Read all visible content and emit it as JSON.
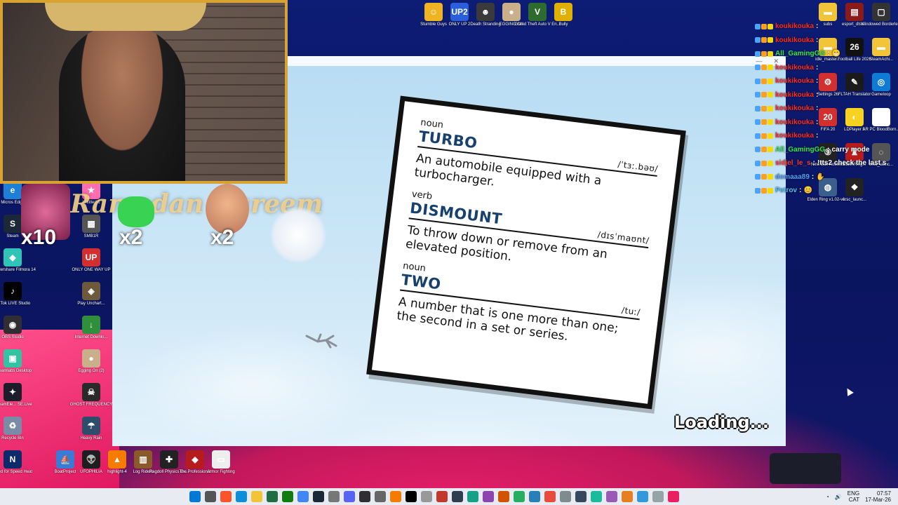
{
  "desktop": {
    "top_icons": [
      {
        "label": "Stumble Guys",
        "icon": "stumble-guys-icon",
        "color": "#f0b322",
        "glyph": "☺"
      },
      {
        "label": "ONLY UP 2",
        "icon": "only-up-icon",
        "color": "#2b5fd9",
        "glyph": "UP2"
      },
      {
        "label": "Death Stranding",
        "icon": "death-stranding-icon",
        "color": "#3a3a3a",
        "glyph": "☻"
      },
      {
        "label": "EGGING ON",
        "icon": "egg-icon",
        "color": "#c9b08a",
        "glyph": "●"
      },
      {
        "label": "Grand Theft Auto V En...",
        "icon": "gta-icon",
        "color": "#2e6b2e",
        "glyph": "V"
      },
      {
        "label": "Bully",
        "icon": "bully-icon",
        "color": "#e0b000",
        "glyph": "B"
      }
    ],
    "left_icons": [
      {
        "label": "Micros Edge",
        "icon": "edge-icon",
        "color": "#1e7fd6",
        "glyph": "e"
      },
      {
        "label": "Steam",
        "icon": "steam-icon",
        "color": "#1b2838",
        "glyph": "S"
      },
      {
        "label": "Wondershare Filmora 14",
        "icon": "filmora-icon",
        "color": "#2ec4b6",
        "glyph": "◆"
      },
      {
        "label": "TikTok LIVE Studio",
        "icon": "tiktok-icon",
        "color": "#000000",
        "glyph": "♪"
      },
      {
        "label": "OBS Studio",
        "icon": "obs-icon",
        "color": "#302e31",
        "glyph": "◉"
      },
      {
        "label": "Streamlabs Desktop",
        "icon": "streamlabs-icon",
        "color": "#31c3a2",
        "glyph": "▣"
      },
      {
        "label": "StreamEle... SE.Live",
        "icon": "streamelements-icon",
        "color": "#1c1c2a",
        "glyph": "✦"
      },
      {
        "label": "Recycle Bin",
        "icon": "recycle-bin-icon",
        "color": "#7a8ba6",
        "glyph": "♻"
      },
      {
        "label": "Need for Speed Heat",
        "icon": "nfs-icon",
        "color": "#0d2a6b",
        "glyph": "N"
      }
    ],
    "left_icons_col2": [
      {
        "label": "Untitled 1",
        "icon": "fall-guys-icon",
        "color": "#ff6fb0",
        "glyph": "★"
      },
      {
        "label": "SMB1R",
        "icon": "smb-icon",
        "color": "#555555",
        "glyph": "▦"
      },
      {
        "label": "ONLY ONE WAY UP",
        "icon": "only-one-way-up-icon",
        "color": "#d32f2f",
        "glyph": "UP"
      },
      {
        "label": "Play Unchart...",
        "icon": "uncharted-icon",
        "color": "#6d5a3c",
        "glyph": "◈"
      },
      {
        "label": "Internet Downlo...",
        "icon": "idm-icon",
        "color": "#2f8f3a",
        "glyph": "↓"
      },
      {
        "label": "Egging On (2)",
        "icon": "egg-icon-2",
        "color": "#c9b08a",
        "glyph": "●"
      },
      {
        "label": "GHOST FREQUENCY",
        "icon": "ghost-icon",
        "color": "#2a2a2a",
        "glyph": "☠"
      },
      {
        "label": "Heavy Rain",
        "icon": "heavy-rain-icon",
        "color": "#2e4d6b",
        "glyph": "☂"
      }
    ],
    "bottom_icons": [
      {
        "label": "BoatProject",
        "icon": "boat-icon",
        "color": "#3a7bd5",
        "glyph": "⛵"
      },
      {
        "label": "UFOPHILIA",
        "icon": "ufo-icon",
        "color": "#1e1e1e",
        "glyph": "👽"
      },
      {
        "label": "highlight-4",
        "icon": "vlc-icon",
        "color": "#f57c00",
        "glyph": "▲"
      },
      {
        "label": "Log Riders",
        "icon": "log-riders-icon",
        "color": "#8b5a2b",
        "glyph": "▥"
      },
      {
        "label": "Ragdoll Physics Ex...",
        "icon": "ragdoll-icon",
        "color": "#222222",
        "glyph": "✚"
      },
      {
        "label": "The Professional",
        "icon": "professional-icon",
        "color": "#b71c1c",
        "glyph": "◆"
      },
      {
        "label": "Armor Fighting",
        "icon": "armor-icon",
        "color": "#eeeeee",
        "glyph": "▭"
      }
    ],
    "right_icons": [
      {
        "label": "subs",
        "icon": "folder-icon",
        "color": "#f2c438",
        "glyph": "▬"
      },
      {
        "label": "esport_dtss...",
        "icon": "winrar-icon",
        "color": "#8b1a1a",
        "glyph": "▤"
      },
      {
        "label": "Windowed Borderle...",
        "icon": "windowed-icon",
        "color": "#333333",
        "glyph": "▢"
      },
      {
        "label": "idle_master...",
        "icon": "folder-icon-2",
        "color": "#f2c438",
        "glyph": "▬"
      },
      {
        "label": "Football Life 2026",
        "icon": "football-icon",
        "color": "#111111",
        "glyph": "26"
      },
      {
        "label": "SteamAchi...",
        "icon": "folder-icon-3",
        "color": "#f2c438",
        "glyph": "▬"
      },
      {
        "label": "Settings 26",
        "icon": "settings-icon",
        "color": "#d32f2f",
        "glyph": "⚙"
      },
      {
        "label": "FLTAH Translator",
        "icon": "translator-icon",
        "color": "#1a1a1a",
        "glyph": "✎"
      },
      {
        "label": "Gameloop",
        "icon": "gameloop-icon",
        "color": "#0e7cd6",
        "glyph": "◎"
      },
      {
        "label": "FIFA 20",
        "icon": "fifa-icon",
        "color": "#d32f2f",
        "glyph": "20"
      },
      {
        "label": "LDPlayer 9",
        "icon": "ldplayer-icon",
        "color": "#f7d21e",
        "glyph": "◐"
      },
      {
        "label": "AR PC BloodBorn...",
        "icon": "bloodborne-icon",
        "color": "#ffffff",
        "glyph": "▯"
      },
      {
        "label": "Nine Ball Roulette",
        "icon": "nine-ball-icon",
        "color": "#222222",
        "glyph": "⑨"
      },
      {
        "label": "EldenRing...",
        "icon": "elden-ring-icon",
        "color": "#b71c1c",
        "glyph": "♜"
      },
      {
        "label": "ersc_launc...",
        "icon": "ersc-icon",
        "color": "#555555",
        "glyph": "◌"
      },
      {
        "label": "Elden Ring v1.02-v1...",
        "icon": "elden-ring-icon-2",
        "color": "#3a5f8a",
        "glyph": "◍"
      },
      {
        "label": "ersc_launc...",
        "icon": "ersc-icon-2",
        "color": "#222222",
        "glyph": "❖"
      }
    ]
  },
  "overlay": {
    "banner": "Ramadan Kareem",
    "multipliers": [
      "x10",
      "x2",
      "x2"
    ]
  },
  "game": {
    "entries": [
      {
        "pos": "noun",
        "word": "TURBO",
        "phonetic": "/ˈtɜː.bəʊ/",
        "definition": "An automobile equipped with a turbocharger."
      },
      {
        "pos": "verb",
        "word": "DISMOUNT",
        "phonetic": "/dɪsˈmaʊnt/",
        "definition": "To throw down or remove from an elevated position."
      },
      {
        "pos": "noun",
        "word": "TWO",
        "phonetic": "/tuː/",
        "definition": "A number that is one more than one; the second in a set or series."
      }
    ],
    "loading": "Loading..."
  },
  "chat": [
    {
      "user": "koukikouka",
      "sep": " :",
      "msg": "",
      "color": "#ff2b2b"
    },
    {
      "user": "koukikouka",
      "sep": " :",
      "msg": "",
      "color": "#ff2b2b"
    },
    {
      "user": "All_GamingGG",
      "sep": " :",
      "msg": "😁",
      "color": "#2ee85a"
    },
    {
      "user": "koukikouka",
      "sep": " :",
      "msg": "",
      "color": "#ff2b2b"
    },
    {
      "user": "koukikouka",
      "sep": " :",
      "msg": "",
      "color": "#ff2b2b"
    },
    {
      "user": "koukikouka",
      "sep": " :",
      "msg": "",
      "color": "#ff2b2b"
    },
    {
      "user": "koukikouka",
      "sep": " :",
      "msg": "",
      "color": "#ff2b2b"
    },
    {
      "user": "koukikouka",
      "sep": " :",
      "msg": "",
      "color": "#ff2b2b"
    },
    {
      "user": "koukikouka",
      "sep": " :",
      "msg": "",
      "color": "#ff2b2b"
    },
    {
      "user": "All_GamingGG",
      "sep": " :",
      "msg": "carry mode",
      "color": "#2ee85a"
    },
    {
      "user": "sidjel_le_s",
      "sep": " :",
      "msg": "!tts2 check the last s",
      "color": "#ff3b3b"
    },
    {
      "user": "domaaa89",
      "sep": " :",
      "msg": "✋",
      "color": "#4fa3ff"
    },
    {
      "user": "Petrov",
      "sep": " :",
      "msg": "😊",
      "color": "#4fc3f7"
    }
  ],
  "taskbar": {
    "icons": [
      "windows-start-icon",
      "search-icon",
      "brave-icon",
      "edge-icon",
      "file-explorer-icon",
      "excel-icon",
      "xbox-icon",
      "chrome-icon",
      "steam-icon",
      "app-icon",
      "discord-icon",
      "obs-icon",
      "settings-icon",
      "vlc-icon",
      "tiktok-icon",
      "app-icon-2",
      "media-icon",
      "app-icon-3",
      "app-icon-4",
      "app-icon-5",
      "app-icon-6",
      "app-icon-7",
      "app-icon-8",
      "app-icon-9",
      "app-icon-10",
      "app-icon-11",
      "app-icon-12",
      "app-icon-13",
      "app-icon-14",
      "app-icon-15",
      "app-icon-16",
      "app-icon-17"
    ],
    "lang": "ENG",
    "region": "CAT",
    "time": "07:57",
    "date": "17-Mar-26"
  }
}
